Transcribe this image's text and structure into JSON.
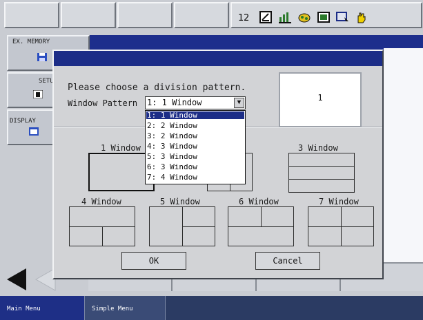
{
  "status_icons": [
    "robot-coordinate-icon",
    "edit-mode-icon",
    "chart-icon",
    "teach-icon",
    "panel-icon",
    "cursor-window-icon",
    "hand-icon"
  ],
  "side_menu": {
    "ex_memory_label": "EX. MEMORY",
    "setup_label": "SETU",
    "display_label": "DISPLAY"
  },
  "dialog": {
    "prompt": "Please choose a division pattern.",
    "window_pattern_label": "Window Pattern",
    "selected_value": "1: 1 Window",
    "preview_number": "1",
    "dropdown_options": [
      "1: 1 Window",
      "2: 2 Window",
      "3: 2 Window",
      "4: 3 Window",
      "5: 3 Window",
      "6: 3 Window",
      "7: 4 Window"
    ],
    "patterns": {
      "p1": "1 Window",
      "p3": "3 Window",
      "p4": "4 Window",
      "p5": "5 Window",
      "p6": "6 Window",
      "p7": "7 Window"
    },
    "ok_label": "OK",
    "cancel_label": "Cancel"
  },
  "bottom_tabs": {
    "main_menu": "Main Menu",
    "simple_menu": "Simple Menu"
  },
  "colors": {
    "title_bar": "#1c2d87",
    "selection": "#1c2d87",
    "bottom_bar": "#2b3b63"
  }
}
